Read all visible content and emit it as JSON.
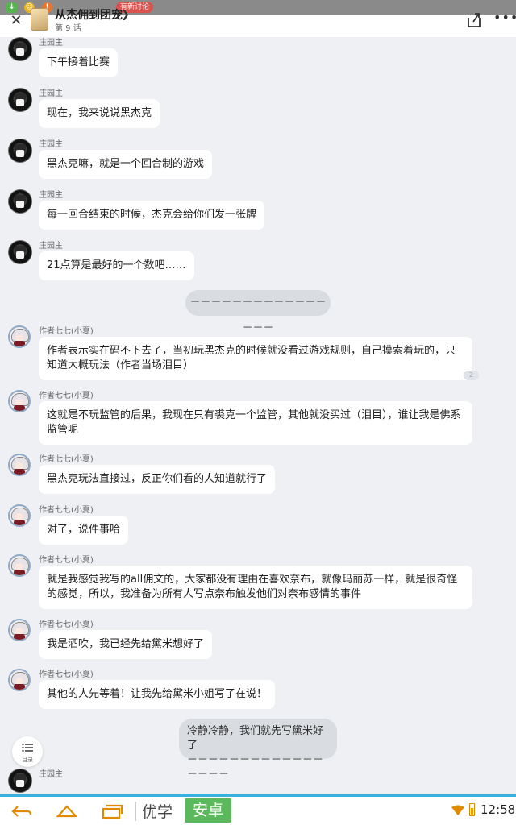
{
  "header": {
    "title": "从杰佣到团宠",
    "chapter": "第 9 话",
    "badge": "有新讨论"
  },
  "messages": [
    {
      "author": "庄园主",
      "text": "下午接着比赛"
    },
    {
      "author": "庄园主",
      "text": "现在，我来说说黑杰克"
    },
    {
      "author": "庄园主",
      "text": "黑杰克嘛，就是一个回合制的游戏"
    },
    {
      "author": "庄园主",
      "text": "每一回合结束的时候，杰克会给你们发一张牌"
    },
    {
      "author": "庄园主",
      "text": "21点算是最好的一个数吧……"
    },
    {
      "system": "－－－－－－－－－－－－－－－－"
    },
    {
      "author": "作者七七(小夏)",
      "text": "作者表示实在码不下去了，当初玩黑杰克的时候就没看过游戏规则，自己摸索着玩的，只知道大概玩法（作者当场泪目）",
      "reply_count": "2"
    },
    {
      "author": "作者七七(小夏)",
      "text": "这就是不玩监管的后果，我现在只有裘克一个监管，其他就没买过（泪目），谁让我是佛系监管呢"
    },
    {
      "author": "作者七七(小夏)",
      "text": "黑杰克玩法直接过，反正你们看的人知道就行了"
    },
    {
      "author": "作者七七(小夏)",
      "text": "对了，说件事哈"
    },
    {
      "author": "作者七七(小夏)",
      "text": "就是我感觉我写的all佣文的，大家都没有理由在喜欢奈布，就像玛丽苏一样，就是很奇怪的感觉，所以，我准备为所有人写点奈布触发他们对奈布感情的事件"
    },
    {
      "author": "作者七七(小夏)",
      "text": "我是酒吹，我已经先给黛米想好了"
    },
    {
      "author": "作者七七(小夏)",
      "text": "其他的人先等着！让我先给黛米小姐写了在说！"
    },
    {
      "system": "冷静冷静，我们就先写黛米好了\n－－－－－－－－－－－－－－－－－"
    },
    {
      "author": "庄园主",
      "text": ""
    }
  ],
  "toc": {
    "label": "目录"
  },
  "navbar": {
    "brand_a": "优学",
    "brand_b": "安卓",
    "time": "12:58"
  }
}
